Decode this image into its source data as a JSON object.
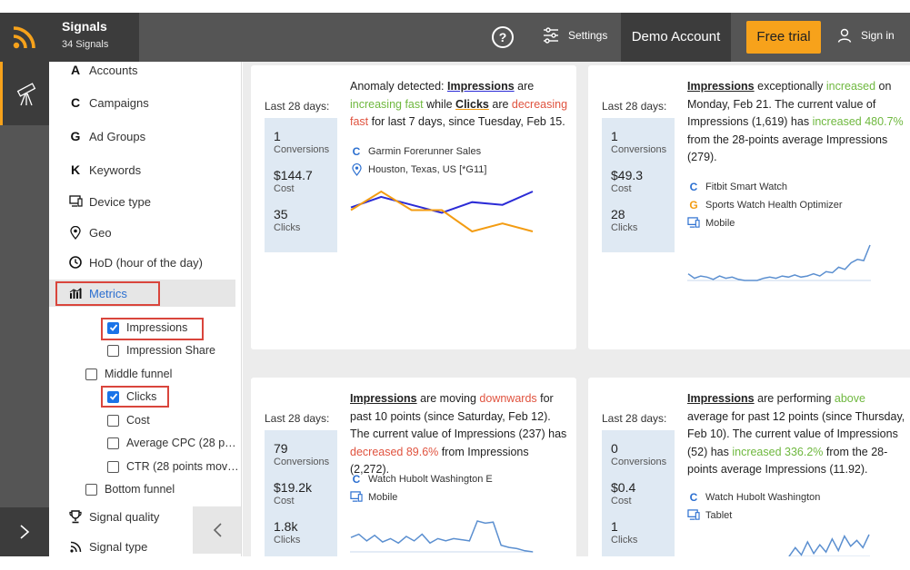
{
  "header": {
    "title": "Signals",
    "count": "34 Signals",
    "help": "?",
    "settings": "Settings",
    "account": "Demo Account",
    "free_trial": "Free trial",
    "sign_in": "Sign in"
  },
  "colors": {
    "accent": "#f7a21b",
    "dark_tile": "#3c3c3c",
    "topbar": "#555555",
    "link_blue": "#2b6fd0",
    "green": "#6fb83f",
    "red": "#e0533f",
    "stat_bg": "#dfe9f3"
  },
  "sidebar": {
    "items": [
      {
        "icon": "A",
        "label": "Accounts"
      },
      {
        "icon": "C",
        "label": "Campaigns"
      },
      {
        "icon": "G",
        "label": "Ad Groups"
      },
      {
        "icon": "K",
        "label": "Keywords"
      },
      {
        "icon": "device-icon",
        "label": "Device type"
      },
      {
        "icon": "location-pin-icon",
        "label": "Geo"
      },
      {
        "icon": "clock-icon",
        "label": "HoD (hour of the day)"
      },
      {
        "icon": "bar-chart-icon",
        "label": "Metrics"
      }
    ],
    "metrics_children": [
      {
        "label": "Impressions",
        "checked": true
      },
      {
        "label": "Impression Share",
        "checked": false
      },
      {
        "label": "Middle funnel",
        "checked": false
      },
      {
        "label": "Clicks",
        "checked": true
      },
      {
        "label": "Cost",
        "checked": false
      },
      {
        "label": "Average CPC (28 p…",
        "checked": false
      },
      {
        "label": "CTR (28 points mov…",
        "checked": false
      },
      {
        "label": "Bottom funnel",
        "checked": false
      }
    ],
    "footer": [
      {
        "icon": "trophy-icon",
        "label": "Signal quality"
      },
      {
        "icon": "rss-icon",
        "label": "Signal type"
      }
    ]
  },
  "cards": [
    {
      "period": "Last 28 days:",
      "stats": [
        {
          "value": "1",
          "label": "Conversions"
        },
        {
          "value": "$144.7",
          "label": "Cost"
        },
        {
          "value": "35",
          "label": "Clicks"
        }
      ],
      "desc": {
        "p1": "Anomaly detected: ",
        "m1": "Impressions",
        "p2": " are ",
        "t1": "increasing fast",
        "p3": " while ",
        "m2": "Clicks",
        "p4": " are ",
        "t2": "decreasing fast",
        "p5": " for last 7 days, since Tuesday, Feb 15."
      },
      "meta": [
        {
          "icon": "C",
          "label": "Garmin Forerunner Sales"
        },
        {
          "icon": "location-pin-icon",
          "label": "Houston, Texas, US [*G11]"
        }
      ],
      "series": [
        {
          "name": "Impressions",
          "color": "#2b2bd6",
          "values": [
            3,
            7,
            4,
            1,
            5,
            4,
            9
          ]
        },
        {
          "name": "Clicks",
          "color": "#f39c12",
          "values": [
            2,
            9,
            2,
            2,
            -6,
            -3,
            -6
          ]
        }
      ]
    },
    {
      "period": "Last 28 days:",
      "stats": [
        {
          "value": "1",
          "label": "Conversions"
        },
        {
          "value": "$49.3",
          "label": "Cost"
        },
        {
          "value": "28",
          "label": "Clicks"
        }
      ],
      "desc": {
        "m1": "Impressions",
        "p1": " exceptionally ",
        "t1": "increased",
        "p2": " on Monday, Feb 21. The current value of Impressions (1,619) has ",
        "t2": "increased 480.7%",
        "p3": " from the 28-points average Impressions (279)."
      },
      "meta": [
        {
          "icon": "C",
          "label": "Fitbit Smart Watch"
        },
        {
          "icon": "G",
          "label": "Sports Watch Health Optimizer"
        },
        {
          "icon": "device-icon",
          "label": "Mobile"
        }
      ],
      "series": [
        {
          "name": "Impressions",
          "color": "#5b8fd0",
          "values": [
            8,
            4,
            6,
            5,
            3,
            6,
            4,
            5,
            3,
            2,
            2,
            2,
            4,
            5,
            4,
            6,
            5,
            7,
            5,
            6,
            8,
            6,
            10,
            9,
            14,
            12,
            18,
            21,
            20,
            34
          ]
        }
      ]
    },
    {
      "period": "Last 28 days:",
      "stats": [
        {
          "value": "79",
          "label": "Conversions"
        },
        {
          "value": "$19.2k",
          "label": "Cost"
        },
        {
          "value": "1.8k",
          "label": "Clicks"
        }
      ],
      "desc": {
        "m1": "Impressions",
        "p1": " are moving ",
        "t1": "downwards",
        "p2": " for past 10 points (since Saturday, Feb 12). The current value of Impressions (237) has ",
        "t2": "decreased 89.6%",
        "p3": " from Impressions (2,272)."
      },
      "meta": [
        {
          "icon": "C",
          "label": "Watch Hubolt Washington E"
        },
        {
          "icon": "device-icon",
          "label": "Mobile"
        }
      ],
      "series": [
        {
          "name": "Impressions",
          "color": "#5b8fd0",
          "values": [
            15,
            18,
            12,
            17,
            11,
            14,
            10,
            16,
            12,
            18,
            10,
            14,
            12,
            14,
            13,
            12,
            30,
            28,
            29,
            8,
            6,
            5,
            3,
            2
          ]
        }
      ]
    },
    {
      "period": "Last 28 days:",
      "stats": [
        {
          "value": "0",
          "label": "Conversions"
        },
        {
          "value": "$0.4",
          "label": "Cost"
        },
        {
          "value": "1",
          "label": "Clicks"
        }
      ],
      "desc": {
        "m1": "Impressions",
        "p1": " are performing ",
        "t1": "above",
        "p2": " average for past 12 points (since Thursday, Feb 10). The current value of Impressions (52) has ",
        "t2": "increased 336.2%",
        "p3": " from the 28-points average Impressions (11.92)."
      },
      "meta": [
        {
          "icon": "C",
          "label": "Watch Hubolt Washington"
        },
        {
          "icon": "device-icon",
          "label": "Tablet"
        }
      ],
      "series": [
        {
          "name": "Impressions",
          "color": "#5b8fd0",
          "values": [
            2,
            8,
            3,
            12,
            4,
            10,
            5,
            14,
            6,
            16,
            9,
            13,
            8,
            17
          ]
        }
      ]
    }
  ]
}
